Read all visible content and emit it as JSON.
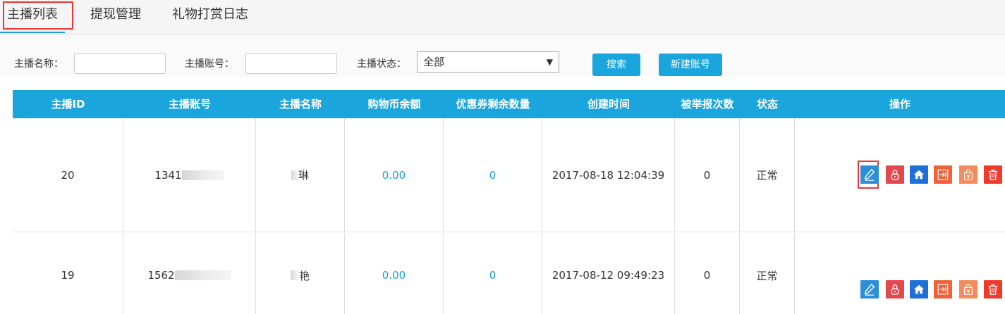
{
  "tabs": [
    {
      "label": "主播列表",
      "active": true
    },
    {
      "label": "提现管理",
      "active": false
    },
    {
      "label": "礼物打赏日志",
      "active": false
    }
  ],
  "filters": {
    "name_label": "主播名称：",
    "name_value": "",
    "account_label": "主播账号：",
    "account_value": "",
    "status_label": "主播状态：",
    "status_value": "全部",
    "search_button": "搜索",
    "new_account_button": "新建账号"
  },
  "table": {
    "headers": [
      "主播ID",
      "主播账号",
      "主播名称",
      "购物币余额",
      "优惠券剩余数量",
      "创建时间",
      "被举报次数",
      "状态",
      "操作"
    ],
    "rows": [
      {
        "id": "20",
        "account": "1341",
        "name": "琳",
        "coins": "0.00",
        "coupons": "0",
        "created": "2017-08-18 12:04:39",
        "reports": "0",
        "status": "正常"
      },
      {
        "id": "19",
        "account": "1562",
        "name": "艳",
        "coins": "0.00",
        "coupons": "0",
        "created": "2017-08-12 09:49:23",
        "reports": "0",
        "status": "正常"
      }
    ],
    "action_icons": [
      "edit-icon",
      "lock-icon",
      "home-icon",
      "export-icon",
      "coupon-icon",
      "trash-icon"
    ]
  },
  "colors": {
    "header_bg": "#1ba5dd",
    "edit": "#2b8fd9",
    "lock": "#e4484e",
    "home": "#1f6fd8",
    "export": "#f0623a",
    "coupon": "#f58b5a",
    "trash": "#f03a2a",
    "highlight": "#e53935"
  }
}
